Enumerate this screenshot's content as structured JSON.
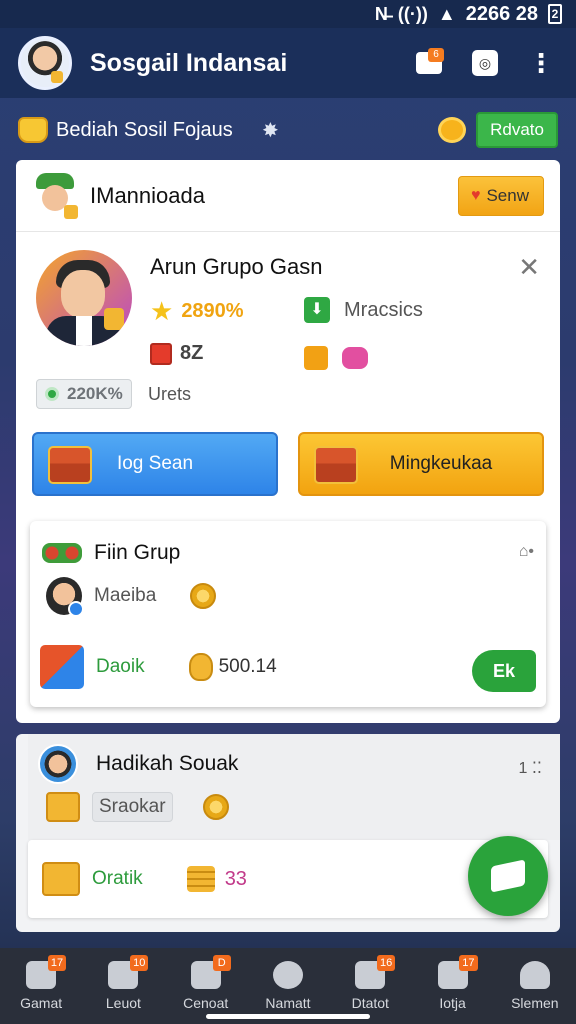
{
  "status_bar": {
    "time": "2266 28",
    "battery": "2"
  },
  "header": {
    "title": "Sosgail Indansai",
    "inbox_badge": "6"
  },
  "sub_header": {
    "title": "Bediah Sosil Fojaus",
    "button_label": "Rdvato"
  },
  "card_main": {
    "name": "IMannioada",
    "top_button_label": "Senw",
    "profile": {
      "name": "Arun Grupo Gasn",
      "star_value": "2890%",
      "download_label": "Mracsics",
      "gift_value": "8Z",
      "pill_value": "220K%",
      "secondary_label": "Urets"
    },
    "actions": {
      "left_label": "Iog Sean",
      "right_label": "Mingkeukaa"
    }
  },
  "group_card": {
    "title": "Fiin Grup",
    "member_label": "Maeiba",
    "item_label": "Daoik",
    "amount": "500.14",
    "action_label": "Ek"
  },
  "gift_card": {
    "title": "Hadikah Souak",
    "dots_label": "1",
    "tag_label": "Sraokar",
    "item_label": "Oratik",
    "amount": "33"
  },
  "bottom_nav": [
    {
      "label": "Gamat",
      "badge": "17"
    },
    {
      "label": "Leuot",
      "badge": "10"
    },
    {
      "label": "Cenoat",
      "badge": "D"
    },
    {
      "label": "Namatt",
      "badge": ""
    },
    {
      "label": "Dtatot",
      "badge": "16"
    },
    {
      "label": "Iotja",
      "badge": "17"
    },
    {
      "label": "Slemen",
      "badge": ""
    }
  ]
}
